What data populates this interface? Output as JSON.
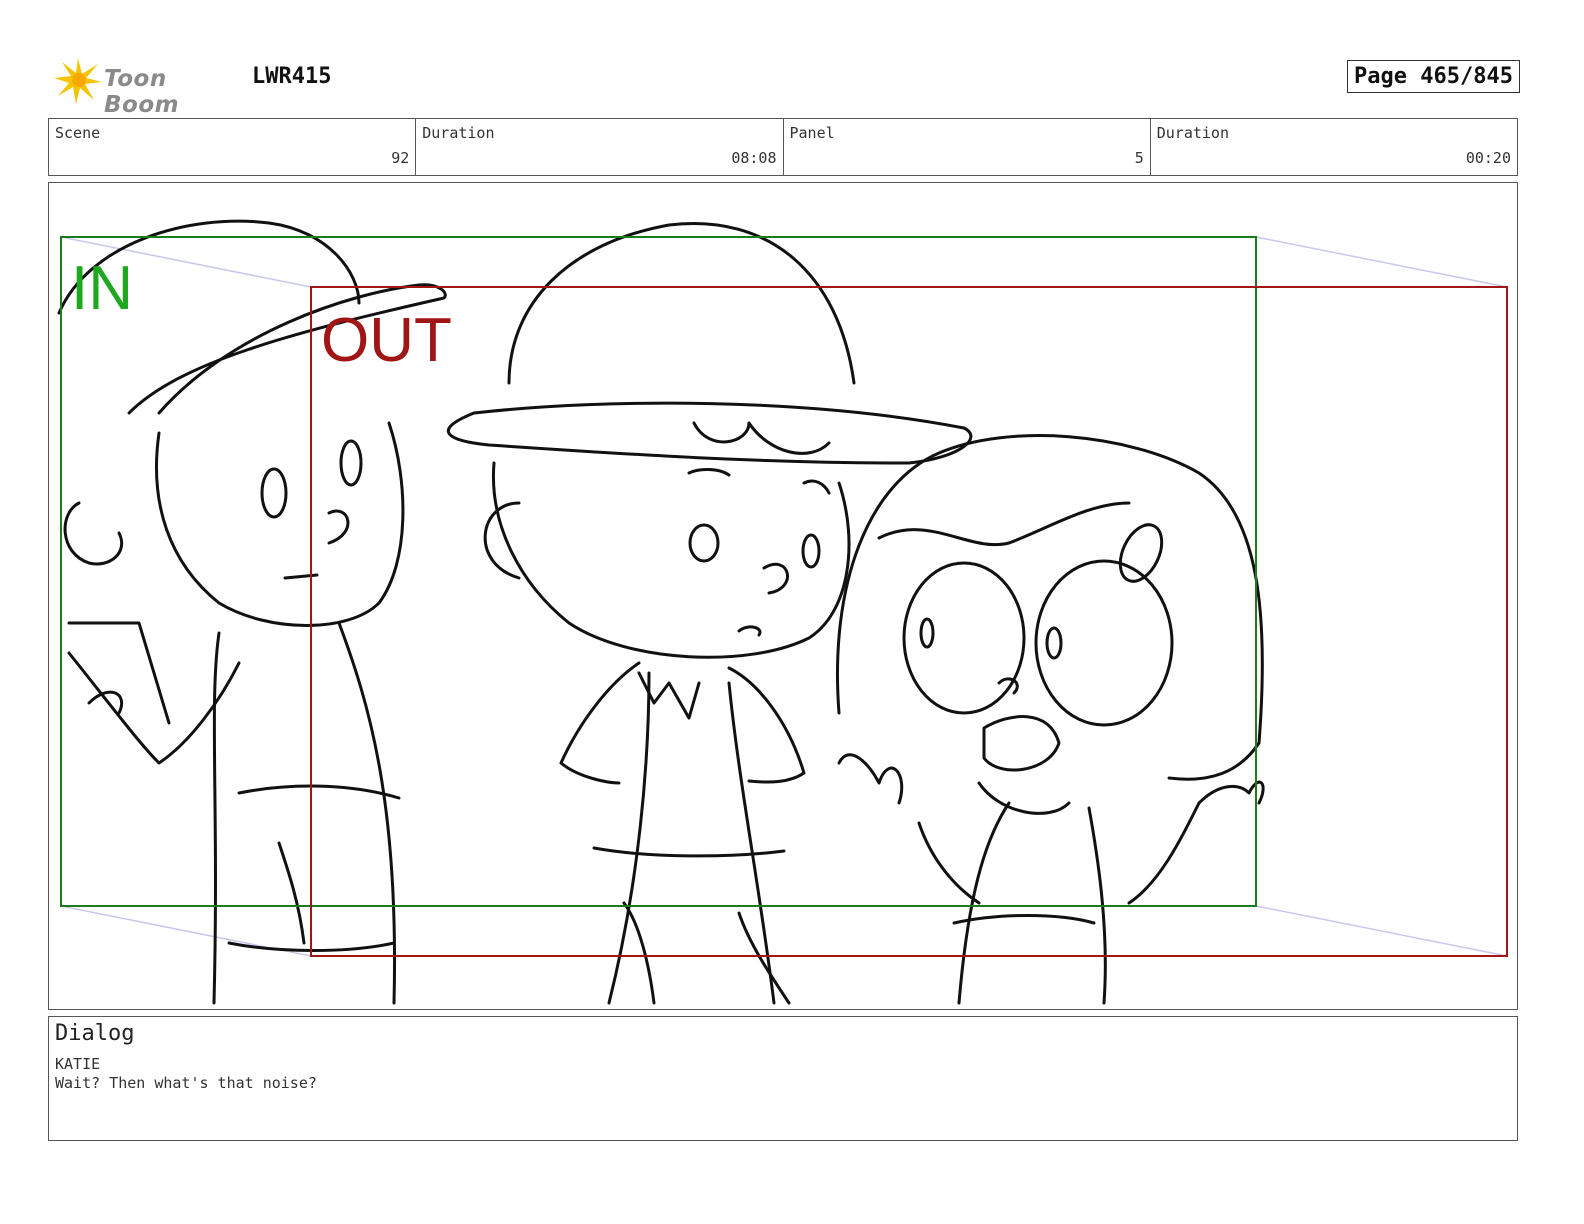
{
  "header": {
    "logo_text": "Toon Boom",
    "project_code": "LWR415",
    "page_label": "Page 465/845"
  },
  "info": {
    "scene_label": "Scene",
    "scene_value": "92",
    "scene_duration_label": "Duration",
    "scene_duration_value": "08:08",
    "panel_label": "Panel",
    "panel_value": "5",
    "panel_duration_label": "Duration",
    "panel_duration_value": "00:20"
  },
  "panel": {
    "in_label": "IN",
    "out_label": "OUT",
    "in_color": "#1e7a1e",
    "out_color": "#a01515",
    "in_text_color": "#1fa81f"
  },
  "dialog": {
    "title": "Dialog",
    "speaker": "KATIE",
    "line": "Wait? Then what's that noise?"
  }
}
